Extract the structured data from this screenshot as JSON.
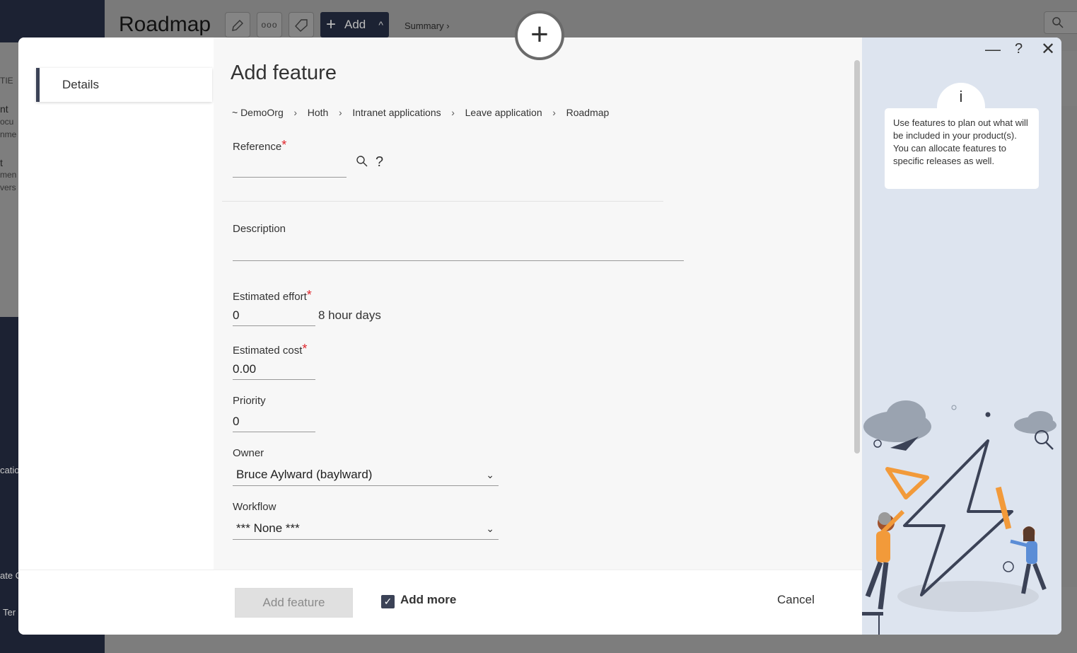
{
  "background": {
    "page_title": "Roadmap",
    "add_label": "Add",
    "summary_link": "Summary ›",
    "leftpanel_snippets": [
      "TIE",
      "nt",
      "ocu",
      "nme",
      "t",
      "men",
      "vers"
    ],
    "leftnav_snippets": [
      "catio",
      "ate C",
      "Ter"
    ]
  },
  "modal": {
    "side_tab": "Details",
    "title": "Add feature",
    "breadcrumb": [
      "~ DemoOrg",
      "Hoth",
      "Intranet applications",
      "Leave application",
      "Roadmap"
    ],
    "reference": {
      "label": "Reference",
      "value": ""
    },
    "description": {
      "label": "Description",
      "value": ""
    },
    "estimated_effort": {
      "label": "Estimated effort",
      "value": "0",
      "unit": "8 hour days"
    },
    "estimated_cost": {
      "label": "Estimated cost",
      "value": "0.00"
    },
    "priority": {
      "label": "Priority",
      "value": "0"
    },
    "owner": {
      "label": "Owner",
      "value": "Bruce Aylward (baylward)"
    },
    "workflow": {
      "label": "Workflow",
      "value": "*** None ***"
    },
    "footer": {
      "add_button": "Add feature",
      "add_more_label": "Add more",
      "add_more_checked": true,
      "cancel": "Cancel"
    }
  },
  "help": {
    "info_icon": "i",
    "text": "Use features to plan out what will be included in your product(s). You can allocate features to specific releases as well."
  },
  "colors": {
    "nav_dark": "#1c2233",
    "accent": "#3b4256",
    "required": "#e0252b",
    "help_bg": "#dde4ef",
    "illustration_orange": "#f29a3a"
  }
}
